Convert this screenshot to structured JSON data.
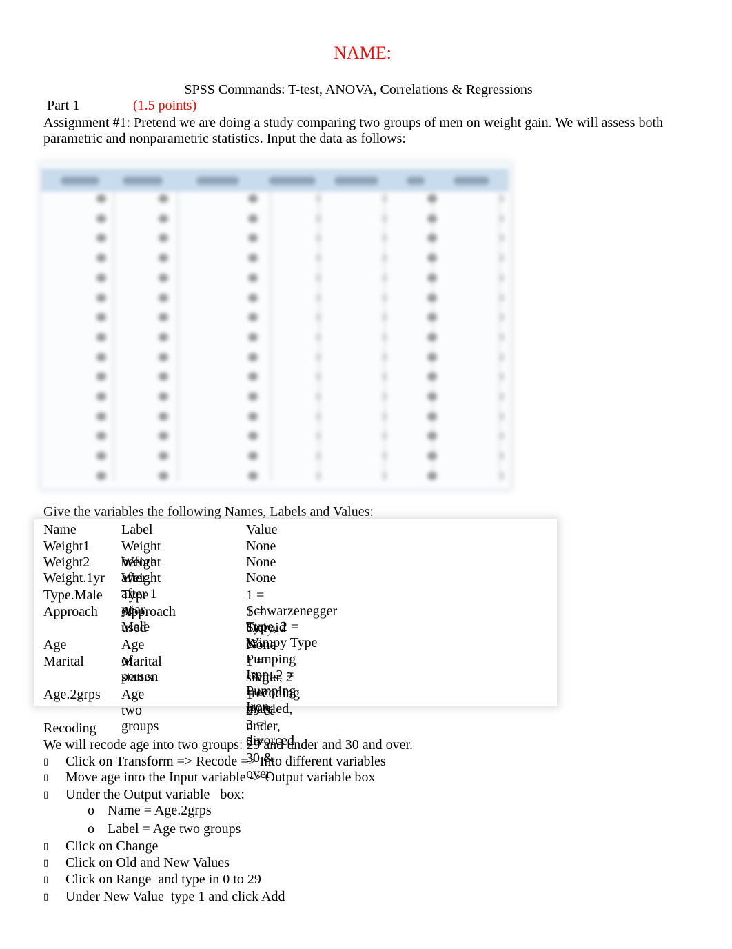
{
  "header": {
    "title": "NAME:",
    "subtitle": "SPSS Commands: T-test, ANOVA, Correlations & Regressions",
    "part": "Part 1",
    "points": "(1.5 points)",
    "assignment": "Assignment #1:  Pretend we are doing a study comparing two groups of men on weight gain.  We will assess both parametric and nonparametric statistics.  Input the data as follows:"
  },
  "data_table": {
    "note": "table contents blurred / illegible",
    "column_count": 7,
    "row_count": 15
  },
  "variables": {
    "intro": "Give the variables the following Names, Labels and Values:",
    "headers": [
      "Name",
      "Label",
      "Value"
    ],
    "rows": [
      {
        "name": "Weight1",
        "label": "Weight before",
        "value": "None"
      },
      {
        "name": "Weight2",
        "label": "Weight after",
        "value": "None"
      },
      {
        "name": "Weight.1yr",
        "label": "Weight after 1 year",
        "value": "None"
      },
      {
        "name": "Type.Male",
        "label": "Type of Male",
        "value": "1 = Schwarzenegger Type, 2 = Wimpy Type"
      },
      {
        "name": "Approach",
        "label": "Approach used",
        "value": "1 = Steroid & Pumping Iron, 2 = Pumping Iron",
        "value_cont": "Only"
      },
      {
        "name": "Age",
        "label": "Age of person",
        "value": "None"
      },
      {
        "name": "Marital",
        "label": "Marital status",
        "value": "1 = single, 2 = married, 3 = divorced"
      },
      {
        "name": "Age.2grps",
        "label": "Age two groups",
        "value": "1 = 29 & under, 2 = 30 & over"
      }
    ],
    "after_recoding_note": "After recoding"
  },
  "recoding": {
    "heading": "Recoding",
    "intro": "We will recode age into two groups: 29 and under and 30 and over.",
    "bullet_glyph": "",
    "sub_glyph": "o",
    "steps": [
      "Click on Transform => Recode => Into different variables",
      "Move age into the Input variable -> Output variable box",
      "Under the Output variable   box:",
      "Click on Change",
      "Click on Old and New Values",
      "Click on Range  and type in 0 to 29",
      "Under New Value  type 1 and click Add"
    ],
    "substeps": [
      "Name = Age.2grps",
      "Label = Age two groups"
    ]
  },
  "colors": {
    "accent_red": "#ff0000",
    "table_header": "#c9dced"
  }
}
